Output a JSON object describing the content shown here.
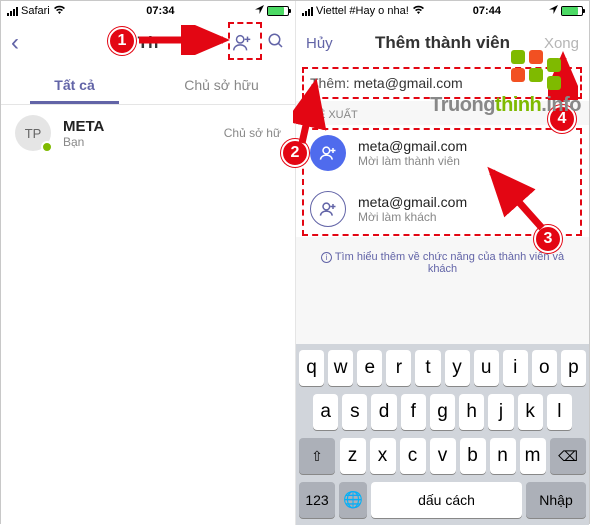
{
  "left": {
    "status": {
      "carrier": "Safari",
      "time": "07:34"
    },
    "nav": {
      "title": "Th"
    },
    "tabs": {
      "all": "Tất cả",
      "owners": "Chủ sở hữu"
    },
    "member": {
      "avatar": "TP",
      "name": "META",
      "sub": "Bạn",
      "role": "Chủ sở hữ"
    }
  },
  "right": {
    "status": {
      "carrier": "Viettel #Hay o nha!",
      "time": "07:44"
    },
    "nav": {
      "cancel": "Hủy",
      "title": "Thêm thành viên",
      "done": "Xong"
    },
    "add": {
      "label": "Thêm:",
      "value": "meta@gmail.com"
    },
    "section": "ĐỀ XUẤT",
    "suggestions": [
      {
        "name": "meta@gmail.com",
        "sub": "Mời làm thành viên"
      },
      {
        "name": "meta@gmail.com",
        "sub": "Mời làm khách"
      }
    ],
    "learn": "Tìm hiểu thêm về chức năng của thành viên và khách",
    "keyboard": {
      "row1": [
        "q",
        "w",
        "e",
        "r",
        "t",
        "y",
        "u",
        "i",
        "o",
        "p"
      ],
      "row2": [
        "a",
        "s",
        "d",
        "f",
        "g",
        "h",
        "j",
        "k",
        "l"
      ],
      "row3": [
        "z",
        "x",
        "c",
        "v",
        "b",
        "n",
        "m"
      ],
      "shift": "⇧",
      "backspace": "⌫",
      "numbers": "123",
      "globe": "🌐",
      "space": "dấu cách",
      "enter": "Nhập"
    }
  },
  "annotations": {
    "badges": [
      "1",
      "2",
      "3",
      "4"
    ]
  },
  "watermark": {
    "t1": "Truong",
    "t2": "thinh",
    "t3": ".info"
  }
}
